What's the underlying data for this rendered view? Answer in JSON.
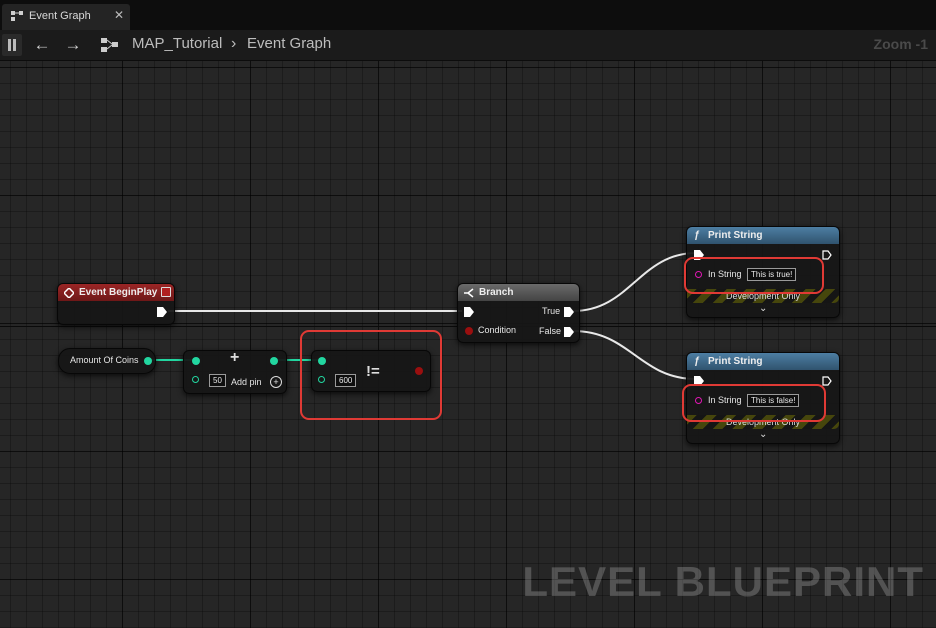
{
  "tab": {
    "label": "Event Graph",
    "close": "✕"
  },
  "toolbar": {
    "back": "←",
    "forward": "→",
    "breadcrumb_level": "MAP_Tutorial",
    "separator": "›",
    "breadcrumb_graph": "Event Graph",
    "zoom": "Zoom -1"
  },
  "nodes": {
    "begin_play": {
      "title": "Event BeginPlay"
    },
    "amount_of_coins": {
      "title": "Amount Of Coins"
    },
    "add": {
      "symbol": "+",
      "value": "50",
      "add_pin_label": "Add pin"
    },
    "not_equal": {
      "symbol": "!=",
      "value": "600"
    },
    "branch": {
      "title": "Branch",
      "condition_label": "Condition",
      "true_label": "True",
      "false_label": "False"
    },
    "print_true": {
      "title": "Print String",
      "in_string_label": "In String",
      "value": "This is true!",
      "dev_label": "Development Only"
    },
    "print_false": {
      "title": "Print String",
      "in_string_label": "In String",
      "value": "This is false!",
      "dev_label": "Development Only"
    }
  },
  "watermark": "LEVEL BLUEPRINT",
  "colors": {
    "exec_wire": "#e8e8e8",
    "integer_pin": "#22d6a0",
    "boolean_pin": "#9a0f0f",
    "string_pin": "#e016b4",
    "highlight": "#e03a35",
    "event_header": "#8c1f1f",
    "function_header": "#3f6c8e",
    "branch_header": "#585858"
  }
}
